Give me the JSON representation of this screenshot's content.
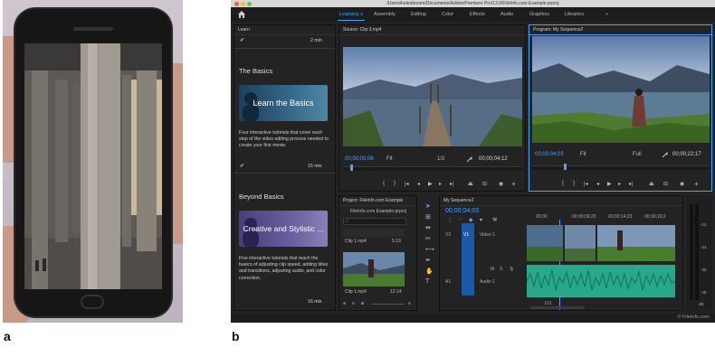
{
  "figure_labels": {
    "a": "a",
    "b": "b"
  },
  "window": {
    "path": "/Users/kelenbroom/Documents/Adobe/Premiere Pro/13.0/FileInfo.com Example.prproj"
  },
  "workspaces": {
    "tabs": [
      "Learning",
      "Assembly",
      "Editing",
      "Color",
      "Effects",
      "Audio",
      "Graphics",
      "Libraries"
    ],
    "active": "Learning",
    "overflow": "»"
  },
  "learn_panel": {
    "title": "Learn",
    "top_duration": "2 min",
    "section1": "The Basics",
    "tile1": "Learn the Basics",
    "desc1": "Four interactive tutorials that cover each step of the video editing process needed to create your first movie.",
    "dur1": "15 min",
    "section2": "Beyond Basics",
    "tile2": "Creative and Stylistic ...",
    "desc2": "Five interactive tutorials that teach the basics of adjusting clip speed, adding titles and transitions, adjusting audio, and color correction.",
    "dur2": "16 min"
  },
  "source_monitor": {
    "title": "Source: Clip 3.mp4",
    "timecode": "00;00;00;06",
    "fit": "Fit",
    "resolution": "1/2",
    "duration": "00;00;04;12"
  },
  "program_monitor": {
    "title": "Program: My Sequence2",
    "timecode": "00;00;04;03",
    "fit": "Fit",
    "resolution": "Full",
    "duration": "00;00;22;17"
  },
  "project_panel": {
    "title": "Project: FileInfo.com Example",
    "file": "FileInfo.com Example.prproj",
    "clip1_name": "Clip 1.mp4",
    "clip1_dur": "5:13",
    "clip2_name": "Clip 1.mp4",
    "clip2_dur": "12:14"
  },
  "timeline": {
    "title": "My Sequence2",
    "timecode": "00;00;04;03",
    "ruler": [
      "00;00",
      "00;00;09;23",
      "00;00;14;23",
      "00;00;19;2"
    ],
    "v2": "V2",
    "v1": "V1",
    "video1": "Video 1",
    "a1": "A1",
    "audio1": "Audio 1",
    "zero": "0.0"
  },
  "meters": {
    "labels": [
      "-12",
      "-24",
      "-36",
      "-48"
    ],
    "db": "dB"
  },
  "watermark": "© FileInfo.com",
  "colors": {
    "accent": "#4aa3ff",
    "audio_clip": "#27a88a",
    "video_track": "#1c5aa8"
  }
}
